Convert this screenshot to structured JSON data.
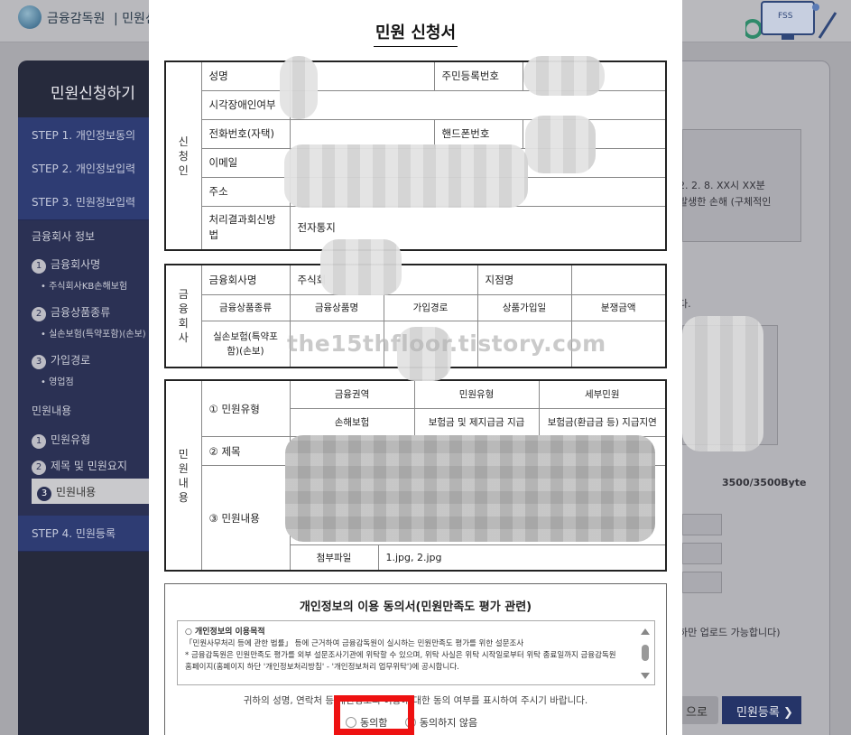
{
  "background": {
    "brand": "금융감독원",
    "brand_suffix": "민원신",
    "fss_label": "FSS",
    "sidebar_title": "민원신청하기",
    "steps": [
      "STEP 1. 개인정보동의",
      "STEP 2. 개인정보입력",
      "STEP 3. 민원정보입력",
      "STEP 4. 민원등록"
    ],
    "sub": {
      "company_header": "금융회사 정보",
      "items": [
        {
          "num": "1",
          "label": "금융회사명",
          "detail": "• 주식회사KB손해보험"
        },
        {
          "num": "2",
          "label": "금융상품종류",
          "detail": "• 실손보험(특약포함)(손보)"
        },
        {
          "num": "3",
          "label": "가입경로",
          "detail": "• 영업점"
        }
      ],
      "complaint_header": "민원내용",
      "complaint_items": [
        {
          "num": "1",
          "label": "민원유형"
        },
        {
          "num": "2",
          "label": "제목 및 민원요지"
        },
        {
          "num": "3",
          "label": "민원내용"
        }
      ]
    },
    "right_text_1": "2. 2. 8. XX시 XX분",
    "right_text_2": "발생한 손해 (구체적인",
    "right_text_3": "다.",
    "byte_counter": "3500/3500Byte",
    "upload_note": "하만 업로드 가능합니다)",
    "prev_button": "으로",
    "register_button": "민원등록  ❯"
  },
  "form": {
    "title": "민원 신청서",
    "applicant": {
      "section": "신청인",
      "name_label": "성명",
      "rrn_label": "주민등록번호",
      "disability_label": "시각장애인여부",
      "phone_label": "전화번호(자택)",
      "mobile_label": "핸드폰번호",
      "email_label": "이메일",
      "address_label": "주소",
      "result_method_label": "처리결과회신방법",
      "result_method_value": "전자통지"
    },
    "company": {
      "section": "금융회사",
      "company_name_label": "금융회사명",
      "company_name_value": "주식회",
      "branch_label": "지점명",
      "headers": [
        "금융상품종류",
        "금융상품명",
        "가입경로",
        "상품가입일",
        "분쟁금액"
      ],
      "product_type": "실손보험(특약포함)(손보)"
    },
    "complaint": {
      "section": "민원내용",
      "type_label": "① 민원유형",
      "type_headers": [
        "금융권역",
        "민원유형",
        "세부민원"
      ],
      "type_values": [
        "손해보험",
        "보험금 및 제지급금 지급",
        "보험금(환급금 등) 지급지연"
      ],
      "subject_label": "② 제목",
      "content_label": "③ 민원내용",
      "attachment_label": "첨부파일",
      "attachment_value": "1.jpg, 2.jpg"
    },
    "watermark": "the15thfloor.tistory.com"
  },
  "consent": {
    "title": "개인정보의 이용 동의서(민원만족도 평가 관련)",
    "lines": [
      "○ 개인정보의 이용목적",
      "「민원사무처리 등에 관한 법률」 등에 근거하여 금융감독원이 실시하는 민원만족도 평가를 위한 설문조사",
      "* 금융감독원은 민원만족도 평가를 외부 설문조사기관에 위탁할 수 있으며, 위탁 사실은 위탁 시작일로부터 위탁 종료일까지 금융감독원",
      "홈페이지(홈페이지 하단 '개인정보처리방침' - '개인정보처리 업무위탁')에 공시합니다."
    ],
    "message": "귀하의 성명, 연락처 등 개인정보의 이용에 대한 동의 여부를 표시하여 주시기 바랍니다.",
    "agree": "동의함",
    "disagree": "동의하지 않음"
  },
  "colors": {
    "highlight": "#ee1111",
    "step_bg": "#2e3c73",
    "sidebar_bg": "#262a3c"
  }
}
